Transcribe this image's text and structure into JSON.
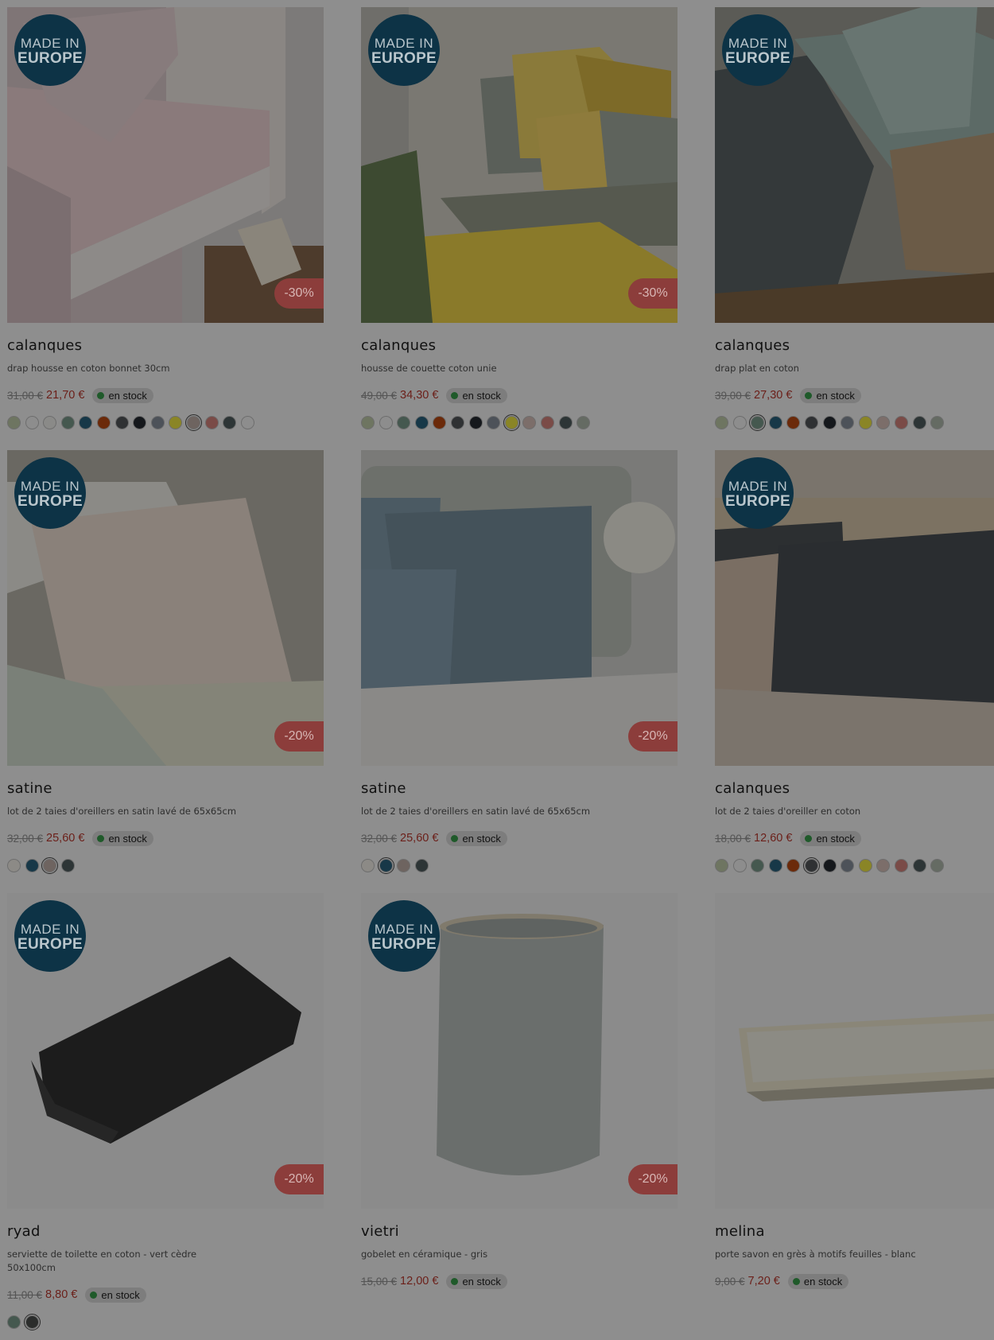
{
  "colors": {
    "badge_bg": "#0d3346",
    "discount_bg": "#8c3d3b",
    "sale_price": "#6b1f19",
    "stock_dot": "#1f5a2a"
  },
  "products": [
    {
      "brand": "calanques",
      "desc": "drap housse en coton bonnet 30cm",
      "old_price": "31,00 €",
      "price": "21,70 €",
      "stock": "en stock",
      "badge": {
        "l1": "MADE IN",
        "l2": "EUROPE"
      },
      "discount": "-30%",
      "swatches": [
        "#6e7561",
        "#8d8d8d",
        "#8a8a88",
        "#45584f",
        "#173848",
        "#6b2a0a",
        "#2f3133",
        "#15181c",
        "#4d5259",
        "#8a8526",
        "#6e6460",
        "#7a4b47",
        "#2d3536",
        "#8d8d8d"
      ],
      "selected": 10
    },
    {
      "brand": "calanques",
      "desc": "housse de couette coton unie",
      "old_price": "49,00 €",
      "price": "34,30 €",
      "stock": "en stock",
      "badge": {
        "l1": "MADE IN",
        "l2": "EUROPE"
      },
      "discount": "-30%",
      "swatches": [
        "#6e7561",
        "#8d8d8d",
        "#45584f",
        "#173848",
        "#6b2a0a",
        "#2f3133",
        "#15181c",
        "#4d5259",
        "#8a8526",
        "#7c6e6a",
        "#7a4b47",
        "#2d3536",
        "#656b63"
      ],
      "selected": 8
    },
    {
      "brand": "calanques",
      "desc": "drap plat en coton",
      "old_price": "39,00 €",
      "price": "27,30 €",
      "stock": "en stock",
      "badge": {
        "l1": "MADE IN",
        "l2": "EUROPE"
      },
      "discount": "",
      "swatches": [
        "#6e7561",
        "#8d8d8d",
        "#45584f",
        "#173848",
        "#6b2a0a",
        "#2f3133",
        "#15181c",
        "#4d5259",
        "#8a8526",
        "#7c6e6a",
        "#7a4b47",
        "#2d3536",
        "#656b63"
      ],
      "selected": 2
    },
    {
      "brand": "satine",
      "desc": "lot de 2 taies d'oreillers en satin lavé de 65x65cm",
      "old_price": "32,00 €",
      "price": "25,60 €",
      "stock": "en stock",
      "badge": {
        "l1": "MADE IN",
        "l2": "EUROPE"
      },
      "discount": "-20%",
      "swatches": [
        "#8c8a86",
        "#173848",
        "#6e6460",
        "#2d3536"
      ],
      "selected": 2
    },
    {
      "brand": "satine",
      "desc": "lot de 2 taies d'oreillers en satin lavé de 65x65cm",
      "old_price": "32,00 €",
      "price": "25,60 €",
      "stock": "en stock",
      "badge": {
        "l1": "",
        "l2": ""
      },
      "discount": "-20%",
      "swatches": [
        "#8c8a86",
        "#173848",
        "#6e6460",
        "#2d3536"
      ],
      "selected": 1
    },
    {
      "brand": "calanques",
      "desc": "lot de 2 taies d'oreiller en coton",
      "old_price": "18,00 €",
      "price": "12,60 €",
      "stock": "en stock",
      "badge": {
        "l1": "MADE IN",
        "l2": "EUROPE"
      },
      "discount": "",
      "swatches": [
        "#6e7561",
        "#8d8d8d",
        "#45584f",
        "#173848",
        "#6b2a0a",
        "#2f3133",
        "#15181c",
        "#4d5259",
        "#8a8526",
        "#7c6e6a",
        "#7a4b47",
        "#2d3536",
        "#656b63"
      ],
      "selected": 5
    },
    {
      "brand": "ryad",
      "desc": "serviette de toilette en coton - vert cèdre 50x100cm",
      "old_price": "11,00 €",
      "price": "8,80 €",
      "stock": "en stock",
      "badge": {
        "l1": "MADE IN",
        "l2": "EUROPE"
      },
      "discount": "-20%",
      "swatches": [
        "#45584f",
        "#2b2d2c"
      ],
      "selected": 1
    },
    {
      "brand": "vietri",
      "desc": "gobelet en céramique - gris",
      "old_price": "15,00 €",
      "price": "12,00 €",
      "stock": "en stock",
      "badge": {
        "l1": "MADE IN",
        "l2": "EUROPE"
      },
      "discount": "-20%",
      "swatches": [],
      "selected": -1
    },
    {
      "brand": "melina",
      "desc": "porte savon en grès à motifs feuilles - blanc",
      "old_price": "9,00 €",
      "price": "7,20 €",
      "stock": "en stock",
      "badge": {
        "l1": "",
        "l2": ""
      },
      "discount": "",
      "swatches": [],
      "selected": -1
    }
  ]
}
